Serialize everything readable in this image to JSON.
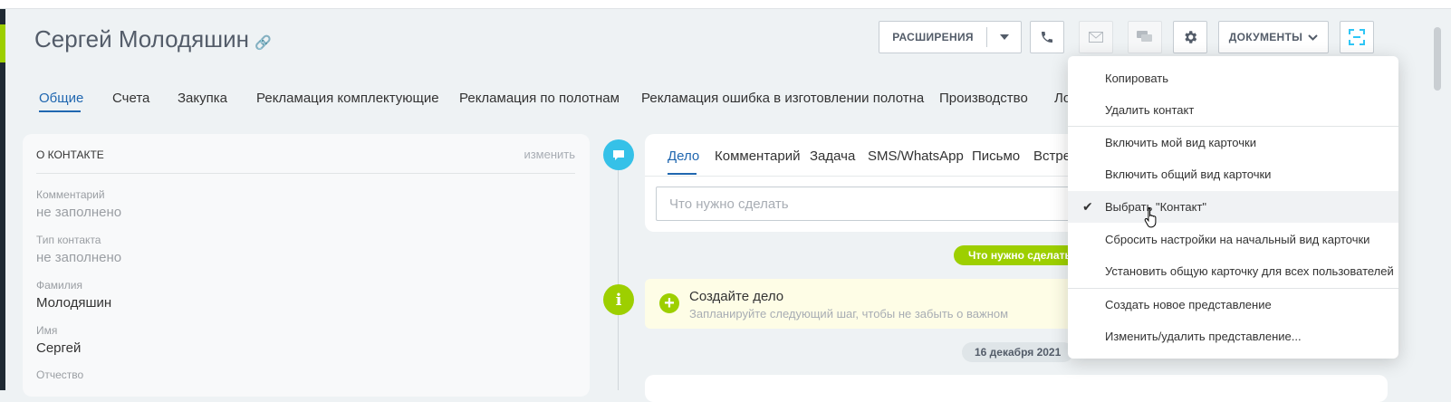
{
  "header": {
    "title": "Сергей Молодяшин",
    "link_icon": "link-icon",
    "extensions_label": "РАСШИРЕНИЯ",
    "documents_label": "ДОКУМЕНТЫ"
  },
  "tabs": [
    {
      "label": "Общие",
      "active": true
    },
    {
      "label": "Счета"
    },
    {
      "label": "Закупка"
    },
    {
      "label": "Рекламация комплектующие"
    },
    {
      "label": "Рекламация по полотнам"
    },
    {
      "label": "Рекламация ошибка в изготовлении полотна"
    },
    {
      "label": "Производство"
    },
    {
      "label": "Ло"
    }
  ],
  "contact_panel": {
    "heading": "О КОНТАКТЕ",
    "edit_label": "изменить",
    "fields": [
      {
        "label": "Комментарий",
        "value": "не заполнено",
        "empty": true
      },
      {
        "label": "Тип контакта",
        "value": "не заполнено",
        "empty": true
      },
      {
        "label": "Фамилия",
        "value": "Молодяшин"
      },
      {
        "label": "Имя",
        "value": "Сергей"
      },
      {
        "label": "Отчество",
        "value": ""
      }
    ]
  },
  "timeline": {
    "editor_tabs": [
      "Дело",
      "Комментарий",
      "Задача",
      "SMS/WhatsApp",
      "Письмо",
      "Встреч"
    ],
    "input_placeholder": "Что нужно сделать",
    "pill_todo": "Что нужно сделать",
    "create_title": "Создайте дело",
    "create_subtitle": "Запланируйте следующий шаг, чтобы не забыть о важном",
    "date_pill": "16 декабря 2021"
  },
  "menu": {
    "items": [
      {
        "label": "Копировать"
      },
      {
        "label": "Удалить контакт"
      },
      {
        "label": "Включить мой вид карточки"
      },
      {
        "label": "Включить общий вид карточки"
      },
      {
        "label": "Выбрать \"Контакт\"",
        "checked": true,
        "highlighted": true
      },
      {
        "label": "Сбросить настройки на начальный вид карточки"
      },
      {
        "label": "Установить общую карточку для всех пользователей"
      },
      {
        "label": "Создать новое представление"
      },
      {
        "label": "Изменить/удалить представление..."
      }
    ]
  },
  "colors": {
    "accent_blue": "#2067b0",
    "accent_green": "#9dcf00",
    "timeline_blue": "#35c1e8"
  }
}
